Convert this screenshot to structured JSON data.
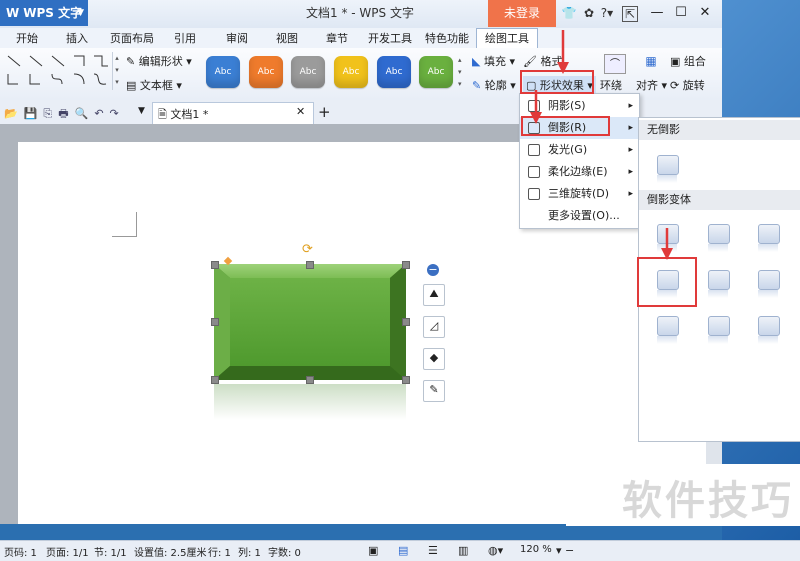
{
  "app": {
    "logo": "WPS 文字",
    "title": "文档1 * - WPS 文字",
    "login": "未登录"
  },
  "title_icons": [
    "shirt-icon",
    "skin-icon",
    "help-icon"
  ],
  "menu_tabs": [
    "开始",
    "插入",
    "页面布局",
    "引用",
    "审阅",
    "视图",
    "章节",
    "开发工具",
    "特色功能",
    "绘图工具"
  ],
  "active_tab": "绘图工具",
  "ribbon": {
    "edit_shape": "编辑形状",
    "textbox": "文本框",
    "style_label": "Abc",
    "style_colors": [
      "#3b7fd4",
      "#ef7b2c",
      "#9b9b9b",
      "#f1c21b",
      "#2f6bd0",
      "#6ab03f"
    ],
    "fill": "填充",
    "outline": "轮廓",
    "format": "格式",
    "shape_effects": "形状效果",
    "wrap": "环绕",
    "align": "对齐",
    "group": "组合",
    "rotate": "旋转"
  },
  "doc_tab": "文档1 *",
  "dropdown": {
    "items": [
      {
        "label": "阴影(S)",
        "arrow": "▸"
      },
      {
        "label": "倒影(R)",
        "arrow": "▸"
      },
      {
        "label": "发光(G)",
        "arrow": "▸"
      },
      {
        "label": "柔化边缘(E)",
        "arrow": "▸"
      },
      {
        "label": "三维旋转(D)",
        "arrow": "▸"
      },
      {
        "label": "更多设置(O)...",
        "arrow": ""
      }
    ]
  },
  "submenu": {
    "none": "无倒影",
    "variants": "倒影变体"
  },
  "status": {
    "page_no": "页码: 1",
    "pages": "页面: 1/1",
    "section": "节: 1/1",
    "setting": "设置值: 2.5厘米",
    "row": "行: 1",
    "col": "列: 1",
    "words": "字数: 0",
    "zoom": "120 %"
  },
  "watermark": "软件技巧",
  "shape": {
    "fill": "#5aa536"
  }
}
